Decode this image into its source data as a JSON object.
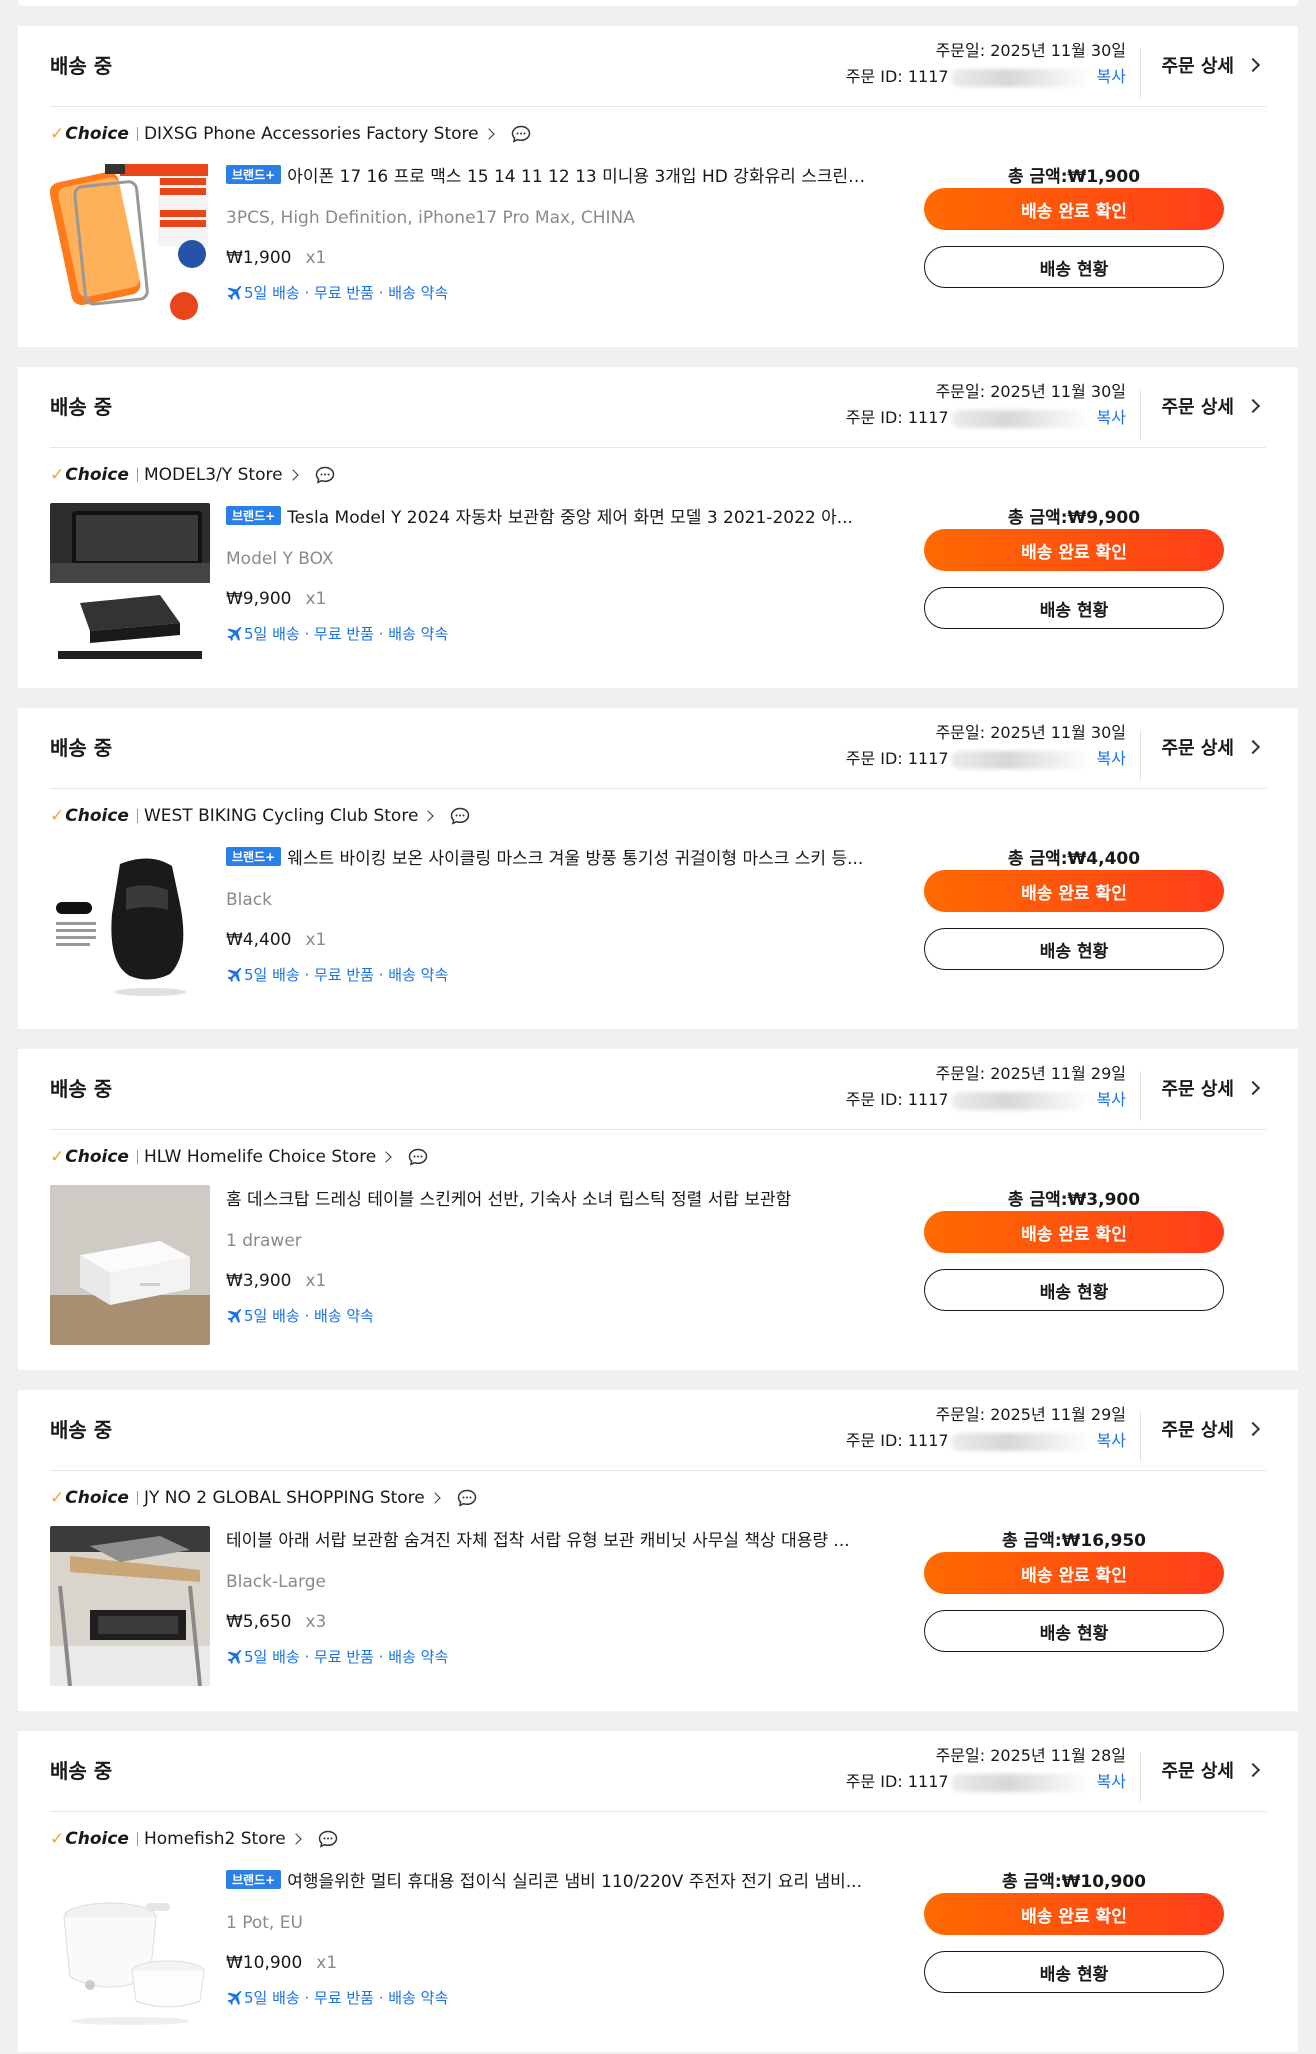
{
  "labels": {
    "status": "배송 중",
    "date_prefix": "주문일: ",
    "id_prefix": "주문 ID: ",
    "copy": "복사",
    "order_detail": "주문 상세",
    "choice": "Choice",
    "brand_badge": "브랜드+",
    "total_prefix": "총 금액:",
    "confirm_delivery": "배송 완료 확인",
    "track_delivery": "배송 현황"
  },
  "colors": {
    "accent_orange": "#ff5a0a",
    "link_blue": "#1a73e8",
    "brand_badge_blue": "#2b7fe8",
    "choice_check": "#f5a623"
  },
  "orders": [
    {
      "date": "2025년 11월 30일",
      "id_visible": "1117",
      "store": "DIXSG Phone Accessories Factory Store",
      "brand_plus": true,
      "title": "아이폰 17 16 프로 맥스 15 14 11 12 13 미니용 3개입 HD 강화유리 스크린 ...",
      "variant": "3PCS, High Definition, iPhone17 Pro Max, CHINA",
      "price": "₩1,900",
      "qty": "x1",
      "tags": "5일 배송 · 무료 반품 · 배송 약속",
      "total": "₩1,900",
      "thumb": "glass-protector"
    },
    {
      "date": "2025년 11월 30일",
      "id_visible": "1117",
      "store": "MODEL3/Y Store",
      "brand_plus": true,
      "title": "Tesla Model Y 2024 자동차 보관함 중앙 제어 화면 모델 3 2021-2022 아...",
      "variant": "Model Y BOX",
      "price": "₩9,900",
      "qty": "x1",
      "tags": "5일 배송 · 무료 반품 · 배송 약속",
      "total": "₩9,900",
      "thumb": "tesla-box"
    },
    {
      "date": "2025년 11월 30일",
      "id_visible": "1117",
      "store": "WEST BIKING Cycling Club Store",
      "brand_plus": true,
      "title": "웨스트 바이킹 보온 사이클링 마스크 겨울 방풍 통기성 귀걸이형 마스크 스키 등...",
      "variant": "Black",
      "price": "₩4,400",
      "qty": "x1",
      "tags": "5일 배송 · 무료 반품 · 배송 약속",
      "total": "₩4,400",
      "thumb": "face-mask"
    },
    {
      "date": "2025년 11월 29일",
      "id_visible": "1117",
      "store": "HLW Homelife Choice Store",
      "brand_plus": false,
      "title": "홈 데스크탑 드레싱 테이블 스킨케어 선반, 기숙사 소녀 립스틱 정렬 서랍 보관함",
      "variant": "1 drawer",
      "price": "₩3,900",
      "qty": "x1",
      "tags": "5일 배송 · 배송 약속",
      "total": "₩3,900",
      "thumb": "drawer-box"
    },
    {
      "date": "2025년 11월 29일",
      "id_visible": "1117",
      "store": "JY NO 2 GLOBAL SHOPPING Store",
      "brand_plus": false,
      "title": "테이블 아래 서랍 보관함 숨겨진 자체 접착 서랍 유형 보관 캐비닛 사무실 책상 대용량 ...",
      "variant": "Black-Large",
      "price": "₩5,650",
      "qty": "x3",
      "tags": "5일 배송 · 무료 반품 · 배송 약속",
      "total": "₩16,950",
      "thumb": "under-desk-drawer"
    },
    {
      "date": "2025년 11월 28일",
      "id_visible": "1117",
      "store": "Homefish2 Store",
      "brand_plus": true,
      "title": "여행을위한 멀티 휴대용 접이식 실리콘 냄비 110/220V 주전자 전기 요리 냄비...",
      "variant": "1 Pot, EU",
      "price": "₩10,900",
      "qty": "x1",
      "tags": "5일 배송 · 무료 반품 · 배송 약속",
      "total": "₩10,900",
      "thumb": "silicone-pot"
    }
  ]
}
